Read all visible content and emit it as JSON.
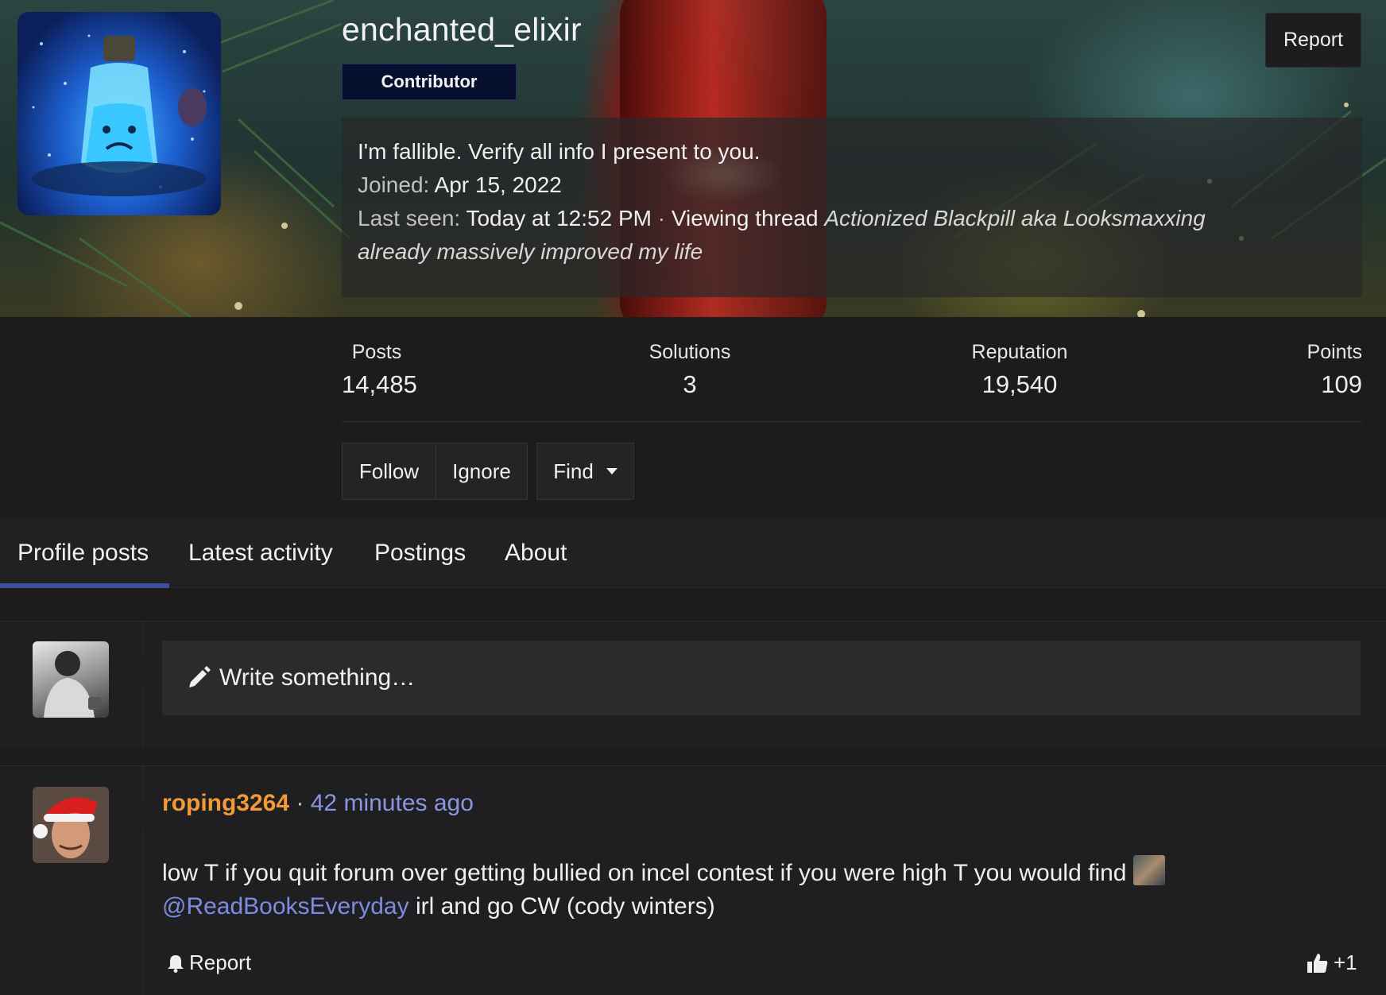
{
  "profile": {
    "username": "enchanted_elixir",
    "role": "Contributor",
    "report_label": "Report",
    "bio": "I'm fallible. Verify all info I present to you.",
    "joined_label": "Joined:",
    "joined_value": "Apr 15, 2022",
    "last_seen_label": "Last seen:",
    "last_seen_value": "Today at 12:52 PM",
    "activity_sep": "·",
    "activity_text": "Viewing thread",
    "activity_thread_line1": "Actionized Blackpill aka Looksmaxxing",
    "activity_thread_line2": "already massively improved my life"
  },
  "stats": [
    {
      "label": "Posts",
      "value": "14,485"
    },
    {
      "label": "Solutions",
      "value": "3"
    },
    {
      "label": "Reputation",
      "value": "19,540"
    },
    {
      "label": "Points",
      "value": "109"
    }
  ],
  "actions": {
    "follow": "Follow",
    "ignore": "Ignore",
    "find": "Find"
  },
  "tabs": [
    {
      "label": "Profile posts",
      "active": true
    },
    {
      "label": "Latest activity",
      "active": false
    },
    {
      "label": "Postings",
      "active": false
    },
    {
      "label": "About",
      "active": false
    }
  ],
  "composer": {
    "placeholder": "Write something…"
  },
  "posts": [
    {
      "author": "roping3264",
      "separator": "·",
      "time": "42 minutes ago",
      "text_part1": "low T if you quit forum over getting bullied on incel contest if you were high T you would find",
      "mention": "@ReadBooksEveryday",
      "text_part2": "irl and go CW (cody winters)",
      "report_label": "Report",
      "like_label": "+1"
    }
  ],
  "colors": {
    "accent": "#3e4f9c",
    "author": "#f29a36",
    "link": "#8a96e0",
    "background": "#1c1c1d"
  }
}
